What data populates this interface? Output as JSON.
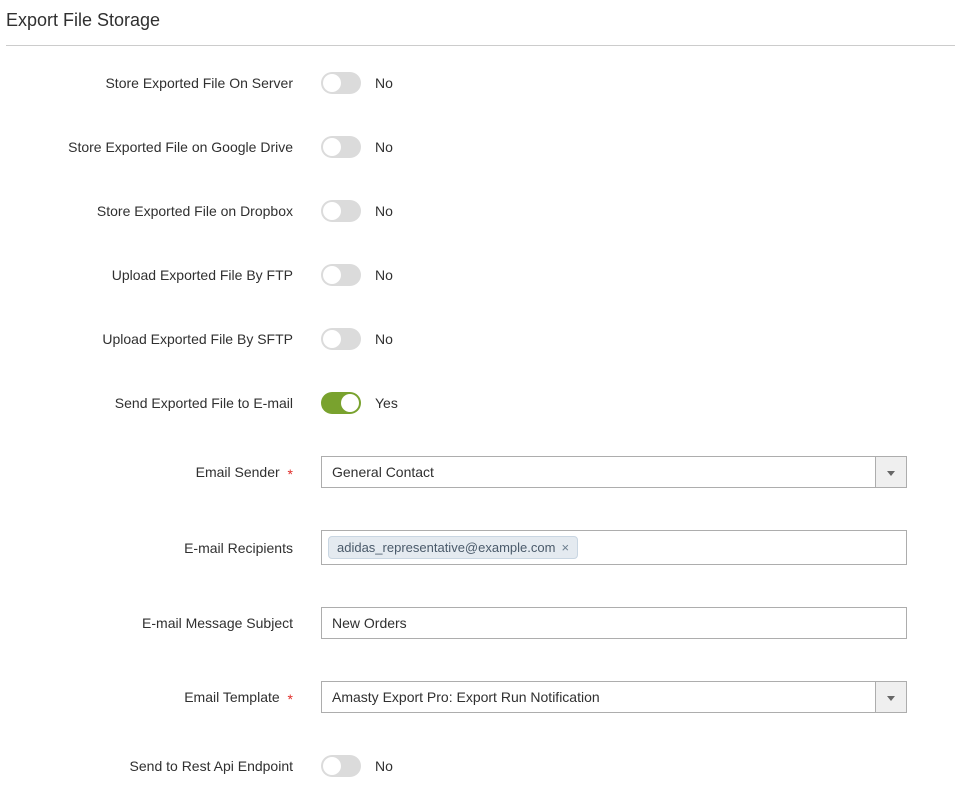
{
  "section": {
    "title": "Export File Storage"
  },
  "toggles": {
    "server": {
      "label": "Store Exported File On Server",
      "state": "off",
      "text": "No"
    },
    "gdrive": {
      "label": "Store Exported File on Google Drive",
      "state": "off",
      "text": "No"
    },
    "dropbox": {
      "label": "Store Exported File on Dropbox",
      "state": "off",
      "text": "No"
    },
    "ftp": {
      "label": "Upload Exported File By FTP",
      "state": "off",
      "text": "No"
    },
    "sftp": {
      "label": "Upload Exported File By SFTP",
      "state": "off",
      "text": "No"
    },
    "email": {
      "label": "Send Exported File to E-mail",
      "state": "on",
      "text": "Yes"
    },
    "restapi": {
      "label": "Send to Rest Api Endpoint",
      "state": "off",
      "text": "No"
    }
  },
  "fields": {
    "sender": {
      "label": "Email Sender",
      "value": "General Contact",
      "required": "*"
    },
    "recipients": {
      "label": "E-mail Recipients",
      "tags": [
        "adidas_representative@example.com"
      ]
    },
    "subject": {
      "label": "E-mail Message Subject",
      "value": "New Orders"
    },
    "template": {
      "label": "Email Template",
      "value": "Amasty Export Pro: Export Run Notification",
      "required": "*"
    }
  },
  "glyphs": {
    "tag_remove": "×"
  }
}
